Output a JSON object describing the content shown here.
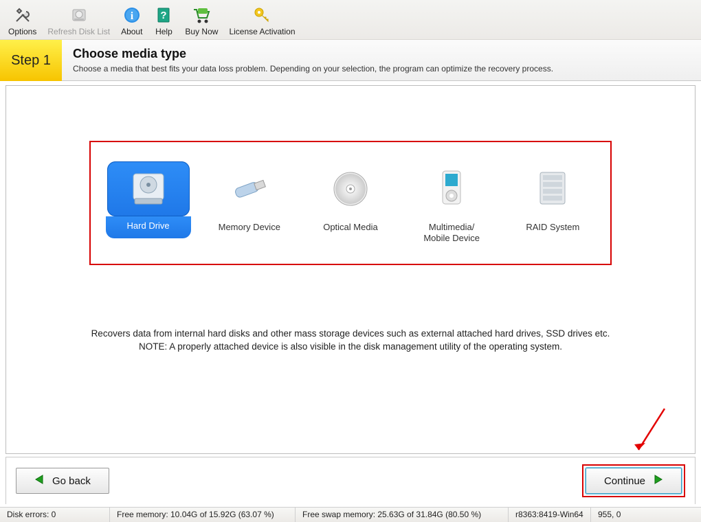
{
  "toolbar": {
    "options": "Options",
    "refresh": "Refresh Disk List",
    "about": "About",
    "help": "Help",
    "buynow": "Buy Now",
    "license": "License Activation"
  },
  "step": {
    "num": "Step 1",
    "title": "Choose media type",
    "sub": "Choose a media that best fits your data loss problem. Depending on your selection, the program can optimize the recovery process."
  },
  "media": {
    "hard": "Hard Drive",
    "memory": "Memory Device",
    "optical": "Optical Media",
    "mobile": "Multimedia/\nMobile Device",
    "raid": "RAID System"
  },
  "description": "Recovers data from internal hard disks and other mass storage devices such as external attached hard drives, SSD drives etc.\n NOTE: A properly attached device is also visible in the disk management utility of the operating system.",
  "nav": {
    "back": "Go back",
    "continue": "Continue"
  },
  "status": {
    "errors": "Disk errors: 0",
    "freemem": "Free memory: 10.04G of 15.92G (63.07 %)",
    "swap": "Free swap memory: 25.63G of 31.84G (80.50 %)",
    "build": "r8363:8419-Win64",
    "coords": "955, 0"
  }
}
